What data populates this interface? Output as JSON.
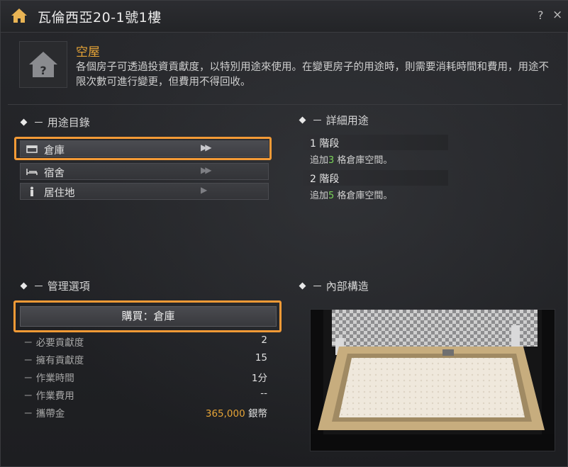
{
  "window": {
    "title": "瓦倫西亞20-1號1樓",
    "help": "?",
    "close": "×"
  },
  "house": {
    "type": "空屋",
    "description": "各個房子可透過投資貢獻度，以特別用途來使用。在變更房子的用途時，則需要消耗時間和費用，用途不限次數可進行變更，但費用不得回收。"
  },
  "sections": {
    "usage_list": "－ 用途目錄",
    "detail": "－ 詳細用途",
    "management": "－ 管理選項",
    "interior": "－ 內部構造"
  },
  "usage_items": [
    {
      "label": "倉庫",
      "icon": "storage-icon",
      "arrows": "▶▶"
    },
    {
      "label": "宿舍",
      "icon": "bed-icon",
      "arrows": "▶▶"
    },
    {
      "label": "居住地",
      "icon": "person-icon",
      "arrows": "▶"
    }
  ],
  "stages": [
    {
      "title": "1 階段",
      "prefix": "追加",
      "num": "3",
      "suffix": " 格倉庫空間。"
    },
    {
      "title": "2 階段",
      "prefix": "追加",
      "num": "5",
      "suffix": " 格倉庫空間。"
    }
  ],
  "buy_button": "購買：倉庫",
  "stats": [
    {
      "key": "－ 必要貢獻度",
      "value": "2"
    },
    {
      "key": "－ 擁有貢獻度",
      "value": "15"
    },
    {
      "key": "－ 作業時間",
      "value": "1分"
    },
    {
      "key": "－ 作業費用",
      "value": "--"
    },
    {
      "key": "－ 攜帶金",
      "money": "365,000",
      "unit": " 銀幣"
    }
  ],
  "colors": {
    "accent_orange": "#e6a437",
    "highlight_border": "#f39a36",
    "green_number": "#7bd35a"
  }
}
